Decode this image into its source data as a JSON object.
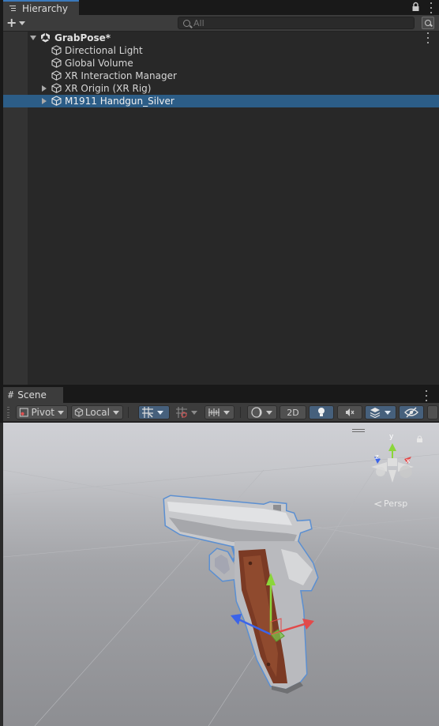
{
  "hierarchy": {
    "tab_label": "Hierarchy",
    "search_placeholder": "All",
    "items": [
      {
        "label": "GrabPose*",
        "type": "scene",
        "expanded": true,
        "depth": 0
      },
      {
        "label": "Directional Light",
        "type": "gameobject",
        "depth": 1
      },
      {
        "label": "Global Volume",
        "type": "gameobject",
        "depth": 1
      },
      {
        "label": "XR Interaction Manager",
        "type": "gameobject",
        "depth": 1
      },
      {
        "label": "XR Origin (XR Rig)",
        "type": "gameobject",
        "depth": 1,
        "has_children": true
      },
      {
        "label": "M1911 Handgun_Silver",
        "type": "gameobject",
        "depth": 1,
        "has_children": true,
        "selected": true
      }
    ]
  },
  "scene": {
    "tab_label": "Scene",
    "toolbar": {
      "pivot_label": "Pivot",
      "local_label": "Local",
      "mode_2d_label": "2D"
    },
    "camera_mode_label": "Persp",
    "gizmo_axes": [
      "y",
      "z",
      "x"
    ]
  },
  "colors": {
    "selection": "#2c5d87",
    "accent_tab": "#3a79bb",
    "axis_x": "#e24a4a",
    "axis_y": "#8bd63a",
    "axis_z": "#3b64ea"
  }
}
